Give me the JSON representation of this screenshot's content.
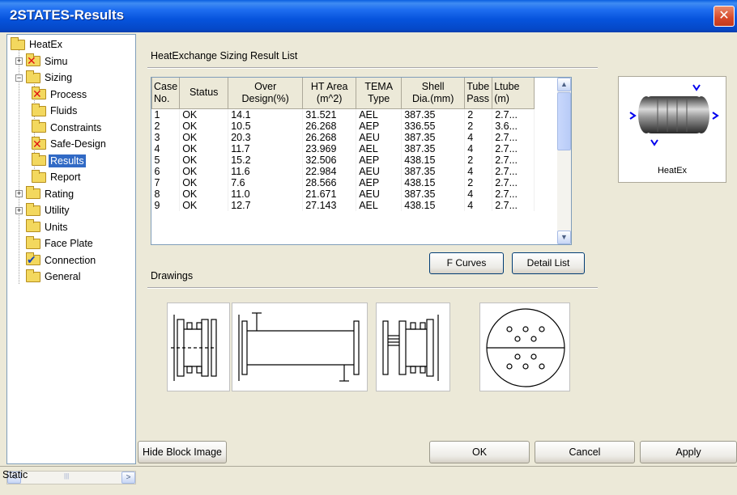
{
  "window": {
    "title": "2STATES-Results",
    "close": "✕"
  },
  "tree": {
    "items": [
      {
        "label": "HeatEx",
        "expander": "",
        "mark": ""
      },
      {
        "label": "Simu",
        "expander": "+",
        "mark": "✕"
      },
      {
        "label": "Sizing",
        "expander": "−",
        "mark": ""
      },
      {
        "label": "Process",
        "expander": "",
        "mark": "✕"
      },
      {
        "label": "Fluids",
        "expander": "",
        "mark": ""
      },
      {
        "label": "Constraints",
        "expander": "",
        "mark": ""
      },
      {
        "label": "Safe-Design",
        "expander": "",
        "mark": "✕"
      },
      {
        "label": "Results",
        "expander": "",
        "mark": "",
        "selected": true
      },
      {
        "label": "Report",
        "expander": "",
        "mark": ""
      },
      {
        "label": "Rating",
        "expander": "+",
        "mark": ""
      },
      {
        "label": "Utility",
        "expander": "+",
        "mark": ""
      },
      {
        "label": "Units",
        "expander": "",
        "mark": ""
      },
      {
        "label": "Face Plate",
        "expander": "",
        "mark": ""
      },
      {
        "label": "Connection",
        "expander": "",
        "mark": "✔"
      },
      {
        "label": "General",
        "expander": "",
        "mark": ""
      }
    ],
    "scroll_left": "<",
    "scroll_right": ">",
    "scroll_grip": "|||"
  },
  "results": {
    "section_title": "HeatExchange Sizing Result List",
    "columns": [
      {
        "line1": "Case",
        "line2": "No."
      },
      {
        "line1": "Status",
        "line2": ""
      },
      {
        "line1": "Over",
        "line2": "Design(%)"
      },
      {
        "line1": "HT Area",
        "line2": "(m^2)"
      },
      {
        "line1": "TEMA",
        "line2": "Type"
      },
      {
        "line1": "Shell",
        "line2": "Dia.(mm)"
      },
      {
        "line1": "Tube",
        "line2": "Pass"
      },
      {
        "line1": "Ltube",
        "line2": "(m)"
      }
    ],
    "rows": [
      [
        "1",
        "OK",
        "14.1",
        "31.521",
        "AEL",
        "387.35",
        "2",
        "2.7..."
      ],
      [
        "2",
        "OK",
        "10.5",
        "26.268",
        "AEP",
        "336.55",
        "2",
        "3.6..."
      ],
      [
        "3",
        "OK",
        "20.3",
        "26.268",
        "AEU",
        "387.35",
        "4",
        "2.7..."
      ],
      [
        "4",
        "OK",
        "11.7",
        "23.969",
        "AEL",
        "387.35",
        "4",
        "2.7..."
      ],
      [
        "5",
        "OK",
        "15.2",
        "32.506",
        "AEP",
        "438.15",
        "2",
        "2.7..."
      ],
      [
        "6",
        "OK",
        "11.6",
        "22.984",
        "AEU",
        "387.35",
        "4",
        "2.7..."
      ],
      [
        "7",
        "OK",
        "7.6",
        "28.566",
        "AEP",
        "438.15",
        "2",
        "2.7..."
      ],
      [
        "8",
        "OK",
        "11.0",
        "21.671",
        "AEU",
        "387.35",
        "4",
        "2.7..."
      ],
      [
        "9",
        "OK",
        "12.7",
        "27.143",
        "AEL",
        "438.15",
        "4",
        "2.7..."
      ]
    ],
    "scroll_up": "▲",
    "scroll_down": "▼",
    "f_curves_label": "F Curves",
    "detail_list_label": "Detail List"
  },
  "drawings": {
    "section_title": "Drawings"
  },
  "block_image": {
    "caption": "HeatEx"
  },
  "buttons": {
    "hide_block_image": "Hide Block Image",
    "ok": "OK",
    "cancel": "Cancel",
    "apply": "Apply"
  },
  "status": {
    "text": "Static"
  },
  "colors": {
    "titlebar": "#0653dc",
    "selection": "#316ac5",
    "error_mark": "#e01010",
    "check_mark": "#1844b8"
  }
}
